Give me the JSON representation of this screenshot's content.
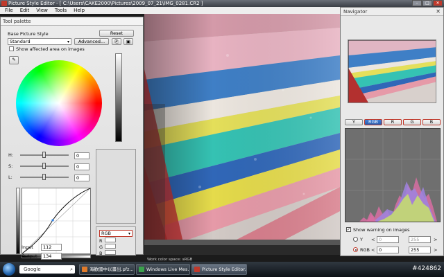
{
  "window": {
    "title": "Picture Style Editor - [ C:\\Users\\CAKE2000\\Pictures\\2009_07_21\\IMG_0281.CR2 ]",
    "controls": [
      "–",
      "□",
      "✕"
    ]
  },
  "menu": [
    "File",
    "Edit",
    "View",
    "Tools",
    "Help"
  ],
  "palette": {
    "title": "Tool palette",
    "base_style_label": "Base Picture Style",
    "reset_label": "Reset",
    "style_select_value": "Standard",
    "advanced_label": "Advanced...",
    "show_affected_label": "Show affected area on images",
    "sliders": [
      {
        "label": "H:",
        "value": "0"
      },
      {
        "label": "S:",
        "value": "0"
      },
      {
        "label": "L:",
        "value": "0"
      }
    ],
    "input_label": "Input",
    "input_value": "112",
    "output_label": "Output",
    "output_value": "134",
    "channel_select": "RGB",
    "channel_fields": [
      "R",
      "G",
      "B"
    ]
  },
  "photo": {
    "status_text": "Work color space: sRGB"
  },
  "navigator": {
    "title": "Navigator",
    "tabs": [
      "Y",
      "RGB",
      "R",
      "G",
      "B"
    ],
    "active_tab": "RGB",
    "show_warning_label": "Show warning on images",
    "rows": [
      {
        "label": "Y",
        "low": "0",
        "high": "255"
      },
      {
        "label": "RGB",
        "low": "0",
        "high": "255"
      }
    ],
    "lt": "<",
    "gt": ">"
  },
  "taskbar": {
    "search_label": "Google",
    "tasks": [
      "海歡國中以畫出.pfz...",
      "Windows Live Mes...",
      "Picture Style Editor..."
    ],
    "watermark": "#424862"
  }
}
